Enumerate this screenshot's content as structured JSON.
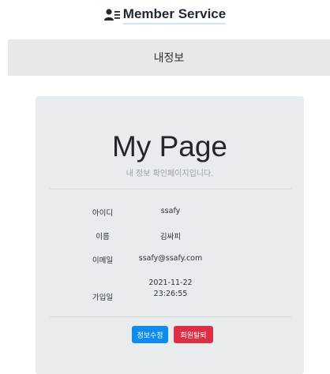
{
  "header": {
    "brand_icon": "user-list-icon",
    "brand_text": "Member Service",
    "accent": "#cde4f3"
  },
  "title_strip": {
    "label": "내정보",
    "background": "#e7e8e9"
  },
  "card": {
    "title": "My Page",
    "subtitle": "내 정보 확인페이지입니다.",
    "rows": [
      {
        "label": "아이디",
        "value": "ssafy"
      },
      {
        "label": "이름",
        "value": "김싸피"
      },
      {
        "label": "이메일",
        "value": "ssafy@ssafy.com"
      },
      {
        "label": "가입일",
        "value_date": "2021-11-22",
        "value_time": "23:26:55"
      }
    ],
    "buttons": {
      "edit_label": "정보수정",
      "delete_label": "회원탈퇴",
      "edit_color": "#0d8bf0",
      "delete_color": "#dc2f45"
    }
  }
}
